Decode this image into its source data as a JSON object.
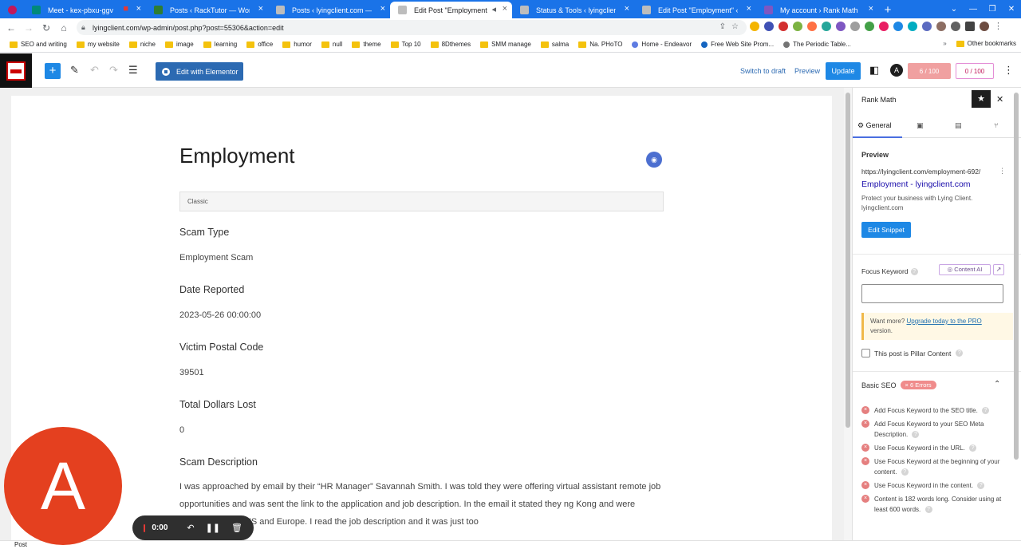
{
  "browser": {
    "tabs": [
      {
        "title": "",
        "color": "#c2185b",
        "active": false
      },
      {
        "title": "Meet - kex-pbxu-ggv",
        "color": "#00897b",
        "active": false
      },
      {
        "title": "Posts ‹ RackTutor — WordPress",
        "color": "#2e7d32",
        "active": false
      },
      {
        "title": "Posts ‹ lyingclient.com — Word",
        "color": "#9e9e9e",
        "active": false
      },
      {
        "title": "Edit Post \"Employment\" ‹ l",
        "color": "#9e9e9e",
        "active": true
      },
      {
        "title": "Status & Tools ‹ lyingclient.com",
        "color": "#9e9e9e",
        "active": false
      },
      {
        "title": "Edit Post \"Employment\" ‹ lying",
        "color": "#9e9e9e",
        "active": false
      },
      {
        "title": "My account › Rank Math",
        "color": "#7e57c2",
        "active": false
      }
    ],
    "url": "lyingclient.com/wp-admin/post.php?post=55306&action=edit",
    "bookmarks": [
      "SEO and writing",
      "my website",
      "niche",
      "image",
      "learning",
      "office",
      "humor",
      "null",
      "theme",
      "Top 10",
      "8Dthemes",
      "SMM manage",
      "salma",
      "Na. PHoTO",
      "Home - Endeavor",
      "Free Web Site Prom...",
      "The Periodic Table..."
    ],
    "other_bookmarks": "Other bookmarks"
  },
  "toolbar": {
    "edit_with_elementor": "Edit with Elementor",
    "switch_to_draft": "Switch to draft",
    "preview": "Preview",
    "update": "Update",
    "seo_score": "6 / 100",
    "readability_score": "0 / 100"
  },
  "post": {
    "title": "Employment",
    "classic_label": "Classic",
    "fields": [
      {
        "label": "Scam Type",
        "value": "Employment Scam"
      },
      {
        "label": "Date Reported",
        "value": "2023-05-26 00:00:00"
      },
      {
        "label": "Victim Postal Code",
        "value": "39501"
      },
      {
        "label": "Total Dollars Lost",
        "value": "0"
      }
    ],
    "description_label": "Scam Description",
    "description": "I was approached by email by their “HR Manager” Savannah Smith. I was told they were offering virtual assistant remote job opportunities and was sent the link to the application and job description. In the email it stated they ng Kong and were spreading to the US and Europe. I read the job description and it was just too"
  },
  "rank_math": {
    "title": "Rank Math",
    "tab_general": "General",
    "preview_heading": "Preview",
    "snippet_url": "https://lyingclient.com/employment-692/",
    "snippet_title": "Employment - lyingclient.com",
    "snippet_desc": "Protect your business with Lying Client.",
    "snippet_domain": "lyingclient.com",
    "edit_snippet": "Edit Snippet",
    "focus_keyword_label": "Focus Keyword",
    "content_ai": "Content AI",
    "promo_text": "Want more? ",
    "promo_link": "Upgrade today to the PRO",
    "promo_tail": "version.",
    "pillar_label": "This post is Pillar Content",
    "basic_seo": "Basic SEO",
    "errors_badge": "× 6 Errors",
    "checks": [
      "Add Focus Keyword to the SEO title.",
      "Add Focus Keyword to your SEO Meta Description.",
      "Use Focus Keyword in the URL.",
      "Use Focus Keyword at the beginning of your content.",
      "Use Focus Keyword in the content.",
      "Content is 182 words long. Consider using at least 600 words."
    ]
  },
  "footer": {
    "label": "Post"
  },
  "recorder": {
    "avatar_letter": "A",
    "time": "0:00"
  }
}
